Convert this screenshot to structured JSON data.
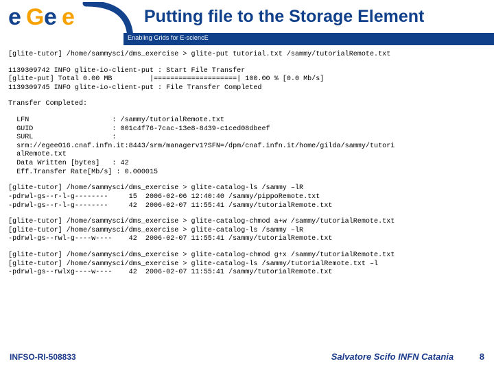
{
  "header": {
    "title": "Putting file to the Storage Element",
    "tagline": "Enabling Grids for E-sciencE",
    "logo": {
      "e1": "e",
      "g": "G",
      "e2": "e",
      "e3": "e"
    }
  },
  "cmd1": "[glite-tutor] /home/sammysci/dms_exercise > glite-put tutorial.txt /sammy/tutorialRemote.txt",
  "out1a": "1139309742 INFO glite-io-client-put : Start File Transfer",
  "out1b": "[glite-put] Total 0.00 MB         |====================| 100.00 % [0.0 Mb/s]",
  "out1c": "1139309745 INFO glite-io-client-put : File Transfer Completed",
  "tc": "Transfer Completed:",
  "lfn": "  LFN                    : /sammy/tutorialRemote.txt",
  "guid": "  GUID                   : 001c4f76-7cac-13e8-8439-c1ced08dbeef",
  "surl": "  SURL                   :",
  "surl2": "  srm://egee016.cnaf.infn.it:8443/srm/managerv1?SFN=/dpm/cnaf.infn.it/home/gilda/sammy/tutori",
  "surl3": "  alRemote.txt",
  "dw": "  Data Written [bytes]   : 42",
  "eff": "  Eff.Transfer Rate[Mb/s] : 0.000015",
  "cmd2": "[glite-tutor] /home/sammysci/dms_exercise > glite-catalog-ls /sammy –lR",
  "ls1": "-pdrwl-gs--r-l-g--------     15  2006-02-06 12:40:40 /sammy/pippoRemote.txt",
  "ls2": "-pdrwl-gs--r-l-g--------     42  2006-02-07 11:55:41 /sammy/tutorialRemote.txt",
  "cmd3": "[glite-tutor] /home/sammysci/dms_exercise > glite-catalog-chmod a+w /sammy/tutorialRemote.txt",
  "cmd4": "[glite-tutor] /home/sammysci/dms_exercise > glite-catalog-ls /sammy –lR",
  "ls3": "-pdrwl-gs--rwl-g----w----    42  2006-02-07 11:55:41 /sammy/tutorialRemote.txt",
  "cmd5": "[glite-tutor] /home/sammysci/dms_exercise > glite-catalog-chmod g+x /sammy/tutorialRemote.txt",
  "cmd6": "[glite-tutor] /home/sammysci/dms_exercise > glite-catalog-ls /sammy/tutorialRemote.txt –l",
  "ls4": "-pdrwl-gs--rwlxg----w----    42  2006-02-07 11:55:41 /sammy/tutorialRemote.txt",
  "footer": {
    "left": "INFSO-RI-508833",
    "right": "Salvatore Scifo INFN Catania",
    "page": "8"
  }
}
